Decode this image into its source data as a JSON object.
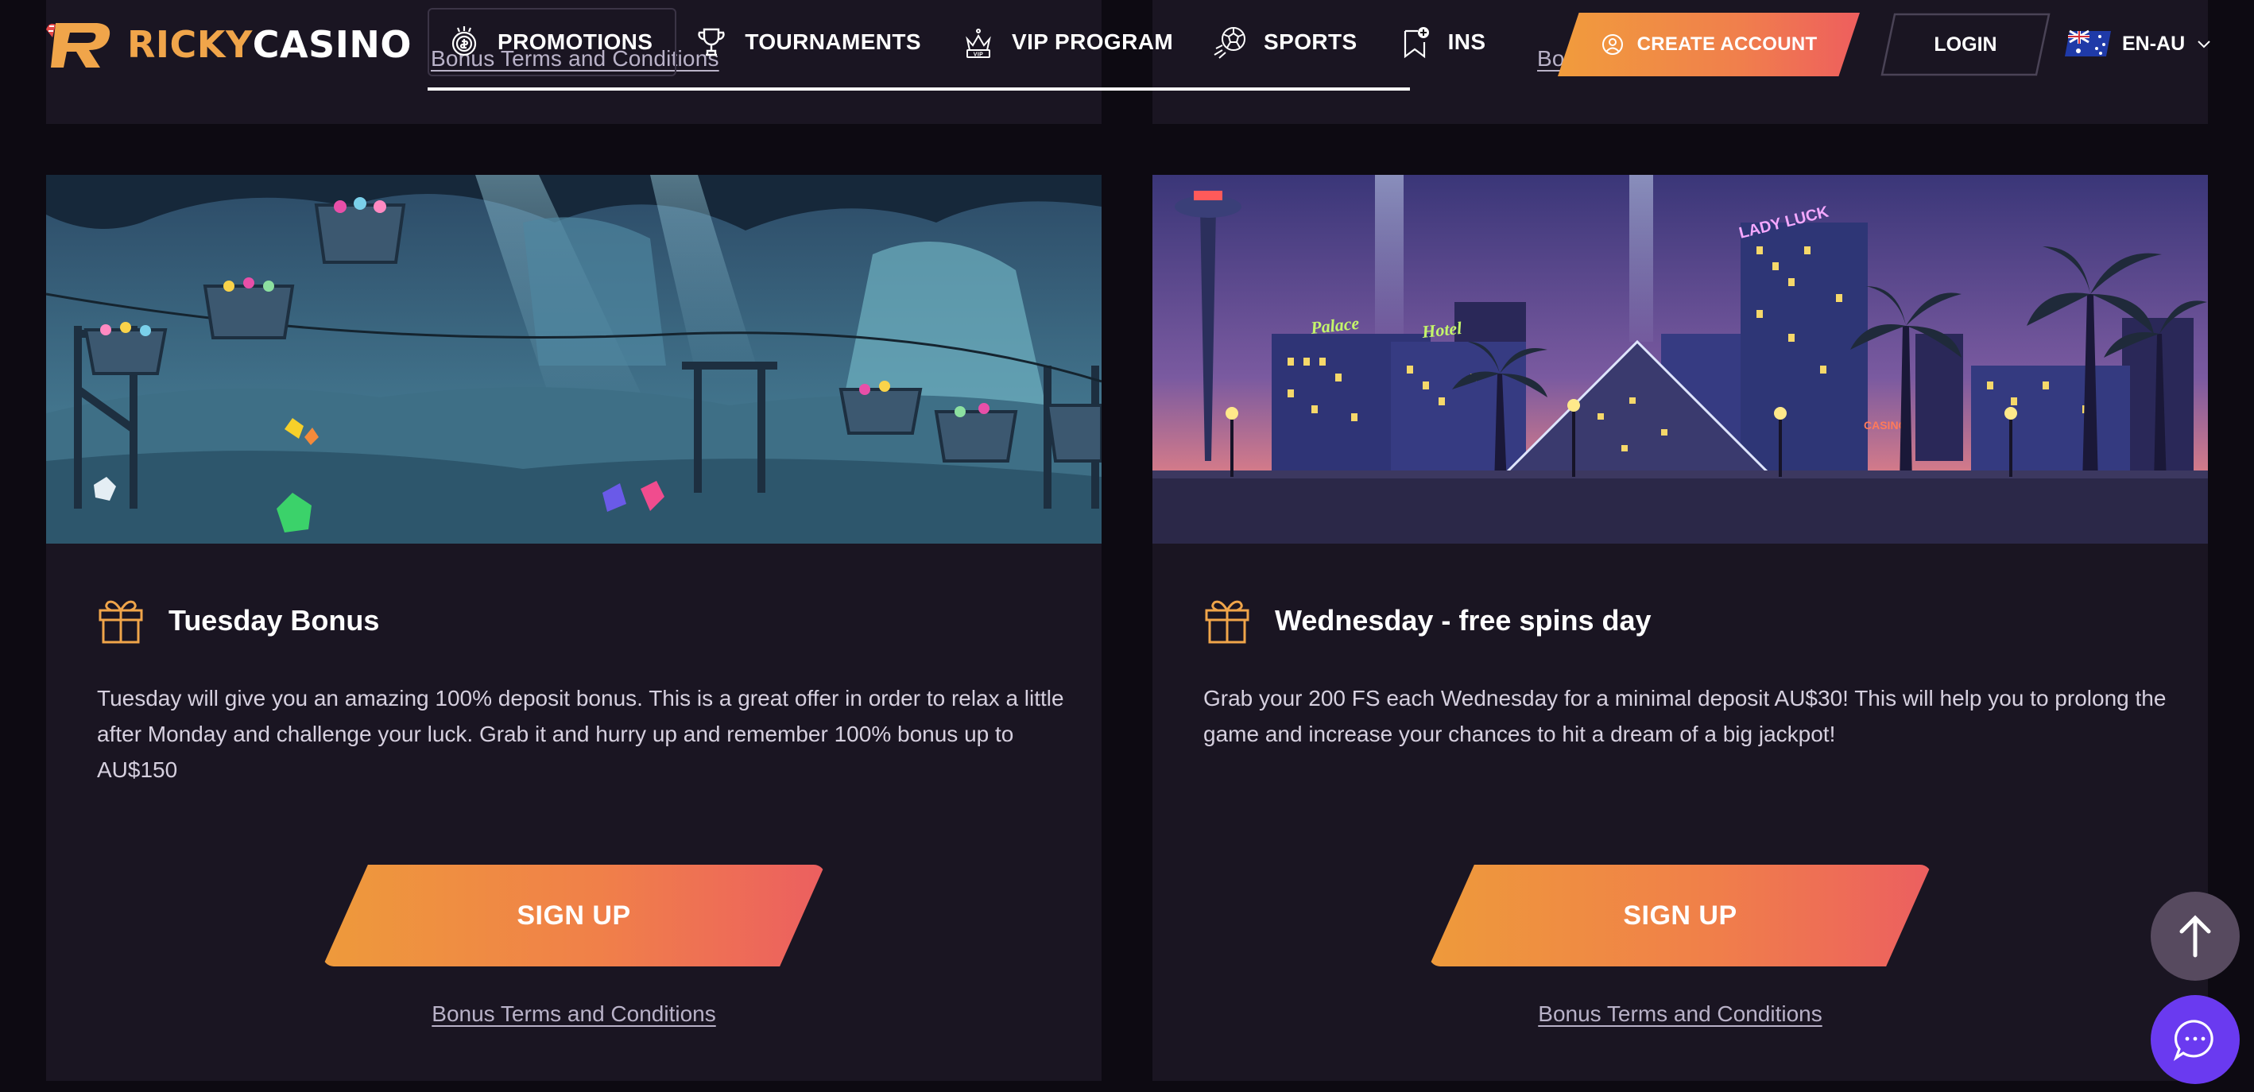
{
  "header": {
    "logo": {
      "part1": "RICKY",
      "part2": "CASINO"
    },
    "nav": [
      {
        "label": "PROMOTIONS",
        "icon": "promotions-coin-icon",
        "active": true
      },
      {
        "label": "TOURNAMENTS",
        "icon": "trophy-icon"
      },
      {
        "label": "VIP PROGRAM",
        "icon": "vip-crown-icon"
      },
      {
        "label": "SPORTS",
        "icon": "soccer-ball-icon"
      },
      {
        "label": "INS",
        "icon": "bookmark-plus-icon"
      }
    ],
    "create_account_label": "CREATE ACCOUNT",
    "login_label": "LOGIN",
    "language": "EN-AU"
  },
  "top_cards": {
    "left_terms": "Bonus Terms and Conditions",
    "right_terms": "Bo"
  },
  "promos": [
    {
      "title": "Tuesday Bonus",
      "description": "Tuesday will give you an amazing 100% deposit bonus. This is a great offer in order to relax a little after Monday and challenge your luck. Grab it and hurry up and remember 100% bonus up to AU$150",
      "button_label": "SIGN UP",
      "terms_label": "Bonus Terms and Conditions",
      "image": "underwater-mine-scene"
    },
    {
      "title": "Wednesday - free spins day",
      "description": "Grab your 200 FS each Wednesday for a minimal deposit AU$30! This will help you to prolong the game and increase your chances to hit a dream of a big jackpot!",
      "button_label": "SIGN UP",
      "terms_label": "Bonus Terms and Conditions",
      "image": "las-vegas-night-scene",
      "image_signs": {
        "palace": "Palace",
        "hotel": "Hotel",
        "lady_luck": "LADY LUCK",
        "casino": "CASINO"
      }
    }
  ],
  "colors": {
    "background": "#0d0a12",
    "card": "#1a1522",
    "accent_orange": "#f19c3c",
    "accent_red": "#ec5f60",
    "chat_purple": "#6a3af0"
  }
}
